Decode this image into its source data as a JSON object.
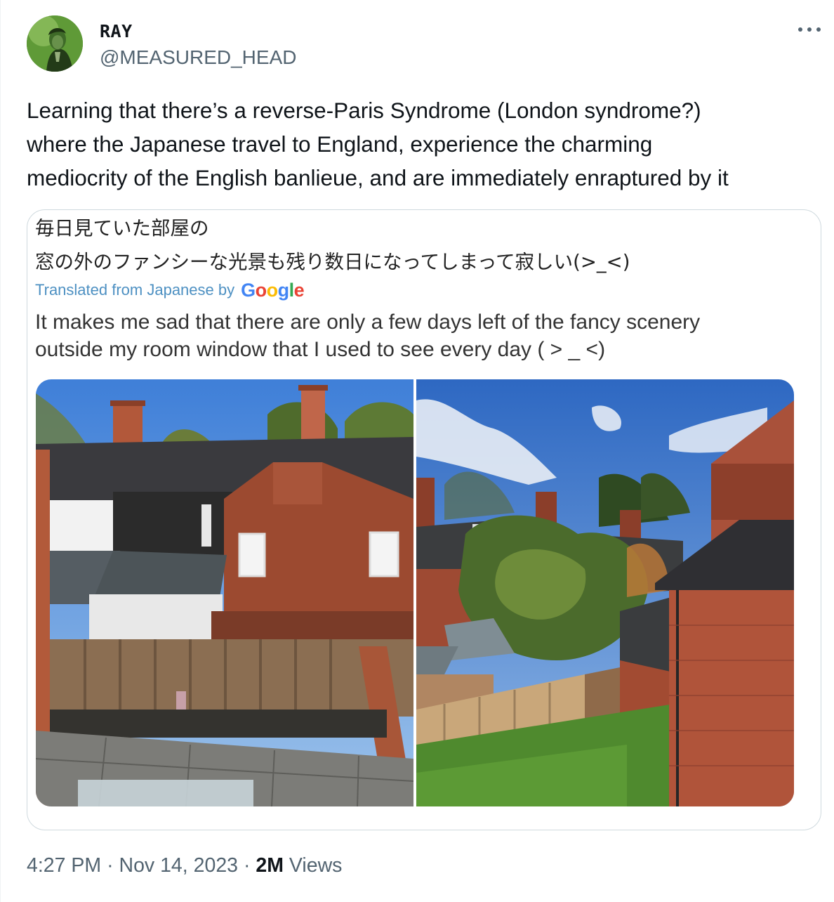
{
  "author": {
    "display_name": "RAY",
    "handle": "@MEASURED_HEAD"
  },
  "tweet": {
    "text_lines": [
      "Learning that there’s a reverse-Paris Syndrome (London syndrome?)",
      "where the Japanese travel to England, experience the charming",
      "mediocrity of the English banlieue, and are immediately enraptured by it"
    ]
  },
  "quoted": {
    "japanese_lines": [
      "毎日見ていた部屋の",
      "窓の外のファンシーな光景も残り数日になってしまって寂しい(>_<)"
    ],
    "translated_label": "Translated from Japanese by",
    "google_logo_text": "Google",
    "translation_lines": [
      "It makes me sad that there are only a few days left of the fancy scenery",
      "outside my room window that I used to see every day ( > _ <)"
    ],
    "images": [
      {
        "icon": "photo-terraced-houses-backyard"
      },
      {
        "icon": "photo-garden-brick-houses-sky"
      }
    ]
  },
  "metadata": {
    "time": "4:27 PM",
    "separator": "·",
    "date": "Nov 14, 2023",
    "views_count": "2M",
    "views_label": "Views"
  },
  "colors": {
    "handle": "#536471",
    "text": "#0f1419",
    "border": "#cfd9de",
    "translated_link": "#4d90c2"
  }
}
